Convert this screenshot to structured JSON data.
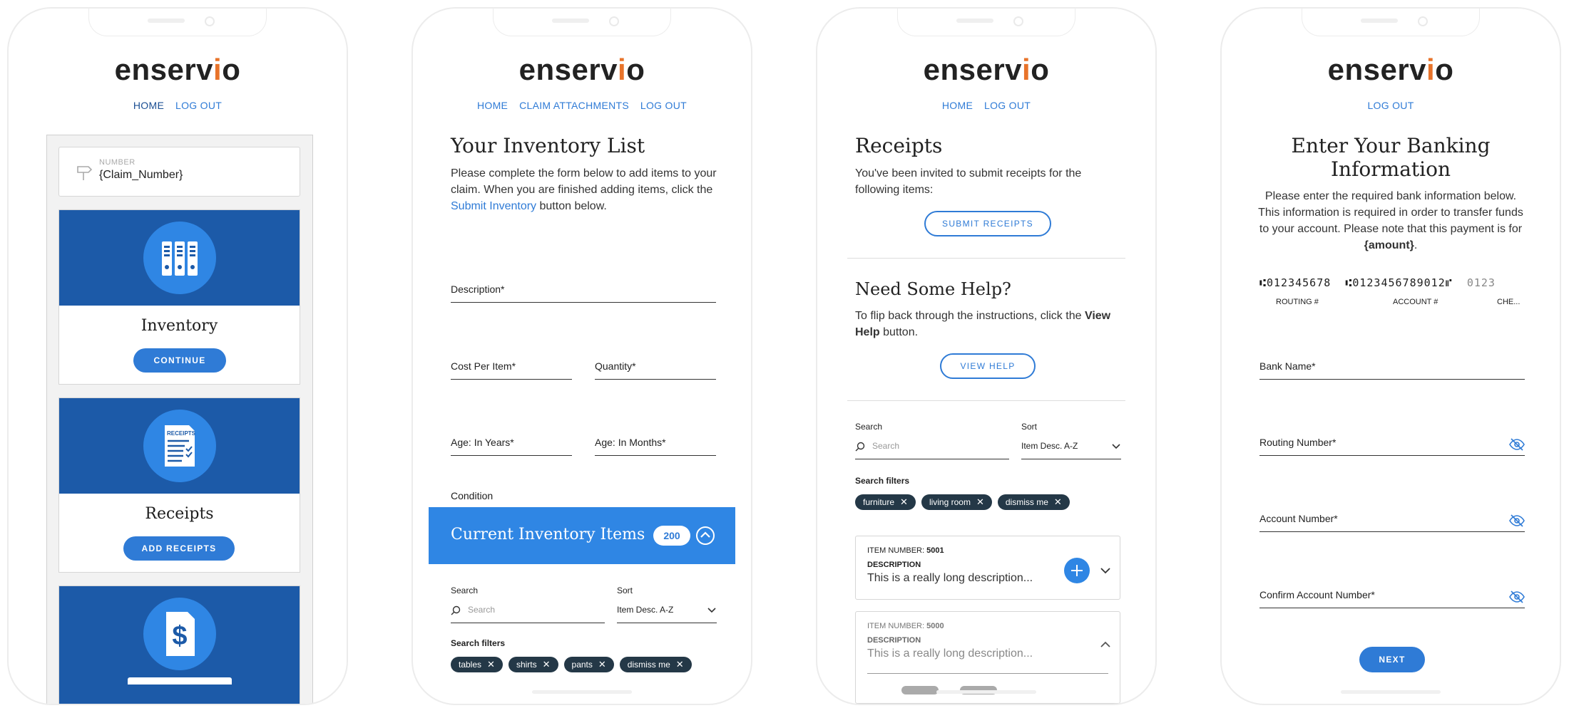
{
  "brand": {
    "logo_main": "enserv",
    "logo_dot": "i",
    "logo_tail": "o"
  },
  "screen1": {
    "nav": [
      "HOME",
      "LOG OUT"
    ],
    "claim_label": "NUMBER",
    "claim_value": "{Claim_Number}",
    "cards": [
      {
        "title": "Inventory",
        "button": "CONTINUE",
        "icon": "binders-icon"
      },
      {
        "title": "Receipts",
        "button": "ADD RECEIPTS",
        "icon": "receipts-icon",
        "icon_text": "RECEIPTS"
      },
      {
        "title": "",
        "button": "",
        "icon": "dollar-document-icon",
        "icon_text": "$"
      }
    ]
  },
  "screen2": {
    "nav": [
      "HOME",
      "CLAIM ATTACHMENTS",
      "LOG OUT"
    ],
    "title": "Your Inventory List",
    "intro_1": "Please complete the form below to add items to your claim. When you are finished adding items, click the ",
    "intro_link": "Submit Inventory",
    "intro_2": " button below.",
    "fields": {
      "description": "Description*",
      "cost": "Cost Per Item*",
      "quantity": "Quantity*",
      "age_years": "Age: In Years*",
      "age_months": "Age: In Months*",
      "condition": "Condition"
    },
    "banner_title": "Current Inventory Items",
    "banner_count": "200",
    "search_label": "Search",
    "search_placeholder": "Search",
    "sort_label": "Sort",
    "sort_value": "Item Desc. A-Z",
    "filters_label": "Search filters",
    "filters": [
      "tables",
      "shirts",
      "pants",
      "dismiss me"
    ]
  },
  "screen3": {
    "nav": [
      "HOME",
      "LOG OUT"
    ],
    "title": "Receipts",
    "intro": "You've been invited to submit receipts for the following items:",
    "submit_button": "SUBMIT RECEIPTS",
    "help_title": "Need Some Help?",
    "help_1": "To flip back through the instructions, click the ",
    "help_bold": "View Help",
    "help_2": " button.",
    "help_button": "VIEW HELP",
    "search_label": "Search",
    "search_placeholder": "Search",
    "sort_label": "Sort",
    "sort_value": "Item Desc. A-Z",
    "filters_label": "Search filters",
    "filters": [
      "furniture",
      "living room",
      "dismiss me"
    ],
    "items": [
      {
        "number_label": "ITEM NUMBER:",
        "number": "5001",
        "desc_label": "DESCRIPTION",
        "desc": "This is a really long description..."
      },
      {
        "number_label": "ITEM NUMBER:",
        "number": "5000",
        "desc_label": "DESCRIPTION",
        "desc": "This is a really long description..."
      }
    ]
  },
  "screen4": {
    "nav": [
      "LOG OUT"
    ],
    "title": "Enter Your Banking Information",
    "intro_1": "Please enter the required bank information below. This information is required in order to transfer funds to your account. Please note that this payment is for ",
    "intro_bold": "{amount}",
    "intro_2": ".",
    "check_routing": "⑆012345678",
    "check_account": "⑆0123456789012⑈",
    "check_number": "0123",
    "check_labels": [
      "ROUTING #",
      "ACCOUNT #",
      "CHE..."
    ],
    "fields": {
      "bank": "Bank Name*",
      "routing": "Routing Number*",
      "account": "Account Number*",
      "confirm": "Confirm Account Number*"
    },
    "next_button": "NEXT"
  },
  "colors": {
    "accent": "#2f7bd6",
    "brand_blue": "#1c5aa8",
    "chip": "#243847",
    "logo_dot": "#e8732a"
  }
}
